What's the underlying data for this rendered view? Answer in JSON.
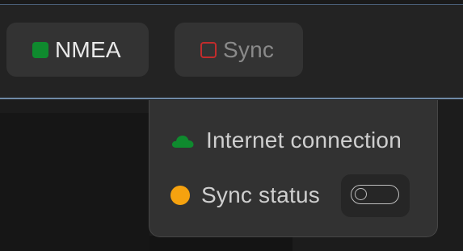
{
  "toolbar": {
    "nmea": {
      "label": "NMEA",
      "indicator_icon": "filled-square-icon",
      "indicator_color": "#0f8a2e"
    },
    "sync": {
      "label": "Sync",
      "indicator_icon": "hollow-square-icon",
      "indicator_color": "#c22c2c"
    }
  },
  "popover": {
    "internet": {
      "label": "Internet connection",
      "icon": "cloud-icon",
      "icon_color": "#0f8a2e"
    },
    "sync_status": {
      "label": "Sync status",
      "icon": "status-dot-icon",
      "icon_color": "#f6a20f",
      "toggle_on": false
    }
  }
}
